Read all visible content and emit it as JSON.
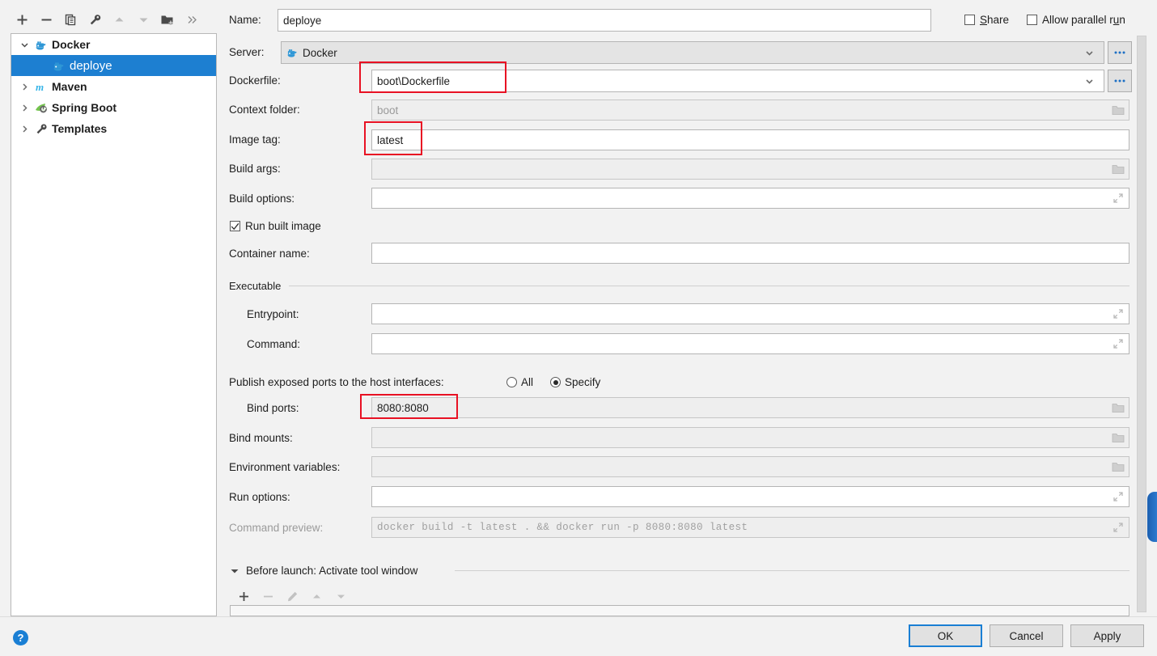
{
  "tree_toolbar": {
    "buttons": [
      {
        "name": "add",
        "icon": "plus-icon",
        "enabled": true
      },
      {
        "name": "remove",
        "icon": "minus-icon",
        "enabled": true
      },
      {
        "name": "copy",
        "icon": "copy-icon",
        "enabled": true
      },
      {
        "name": "edit-templates",
        "icon": "wrench-icon",
        "enabled": true
      },
      {
        "name": "move-up",
        "icon": "arrow-up-icon",
        "enabled": false
      },
      {
        "name": "move-down",
        "icon": "arrow-down-icon",
        "enabled": false
      },
      {
        "name": "new-folder",
        "icon": "folder-add-icon",
        "enabled": true
      },
      {
        "name": "more",
        "icon": "chevrons-right-icon",
        "enabled": true
      }
    ]
  },
  "tree": {
    "items": [
      {
        "label": "Docker",
        "icon": "docker-icon",
        "expanded": true,
        "selected": false,
        "level": 0
      },
      {
        "label": "deploye",
        "icon": "docker-icon",
        "expanded": null,
        "selected": true,
        "level": 1
      },
      {
        "label": "Maven",
        "icon": "maven-icon",
        "expanded": false,
        "selected": false,
        "level": 0
      },
      {
        "label": "Spring Boot",
        "icon": "spring-boot-icon",
        "expanded": false,
        "selected": false,
        "level": 0
      },
      {
        "label": "Templates",
        "icon": "wrench-icon",
        "expanded": false,
        "selected": false,
        "level": 0
      }
    ]
  },
  "header": {
    "name_label": "Name:",
    "name_value": "deploye",
    "share_label_pre": "S",
    "share_label_post": "hare",
    "allow_parallel_pre": "Allow parallel r",
    "allow_parallel_mn": "u",
    "allow_parallel_post": "n",
    "share_checked": false,
    "allow_parallel_checked": false
  },
  "form": {
    "server": {
      "label": "Server:",
      "value": "Docker",
      "icon": "docker-icon",
      "browse_label": "...",
      "enabled": false
    },
    "dockerfile": {
      "label": "Dockerfile:",
      "value": "boot\\Dockerfile",
      "browse_label": "...",
      "highlighted": true
    },
    "context_folder": {
      "label": "Context folder:",
      "value": "",
      "placeholder": "boot",
      "trailing_icon": "folder-icon",
      "disabled": true
    },
    "image_tag": {
      "label": "Image tag:",
      "value": "latest",
      "highlighted": true
    },
    "build_args": {
      "label": "Build args:",
      "value": "",
      "trailing_icon": "folder-icon",
      "disabled": true
    },
    "build_options": {
      "label": "Build options:",
      "value": "",
      "trailing_icon": "expand-icon",
      "disabled": false
    },
    "run_built_image": {
      "label": "Run built image",
      "checked": true
    },
    "container_name": {
      "label": "Container name:",
      "value": "",
      "disabled": false
    },
    "executable_group": {
      "title": "Executable",
      "entrypoint": {
        "label": "Entrypoint:",
        "value": "",
        "trailing_icon": "expand-icon"
      },
      "command": {
        "label": "Command:",
        "value": "",
        "trailing_icon": "expand-icon"
      }
    },
    "publish_ports": {
      "label": "Publish exposed ports to the host interfaces:",
      "options": [
        {
          "label": "All",
          "selected": false
        },
        {
          "label": "Specify",
          "selected": true
        }
      ]
    },
    "bind_ports": {
      "label": "Bind ports:",
      "value": "8080:8080",
      "trailing_icon": "folder-icon",
      "highlighted": true
    },
    "bind_mounts": {
      "label": "Bind mounts:",
      "value": "",
      "trailing_icon": "folder-icon",
      "disabled": true
    },
    "environment_variables": {
      "label": "Environment variables:",
      "value": "",
      "trailing_icon": "folder-icon",
      "disabled": true
    },
    "run_options": {
      "label": "Run options:",
      "value": "",
      "trailing_icon": "expand-icon",
      "disabled": false
    },
    "command_preview": {
      "label": "Command preview:",
      "value": "docker build -t latest . && docker run -p 8080:8080 latest",
      "trailing_icon": "expand-icon",
      "disabled": true
    }
  },
  "before_launch": {
    "title": "Before launch: Activate tool window",
    "expanded": true,
    "toolbar": [
      {
        "name": "add",
        "icon": "plus-icon",
        "enabled": true
      },
      {
        "name": "remove",
        "icon": "minus-icon",
        "enabled": false
      },
      {
        "name": "edit",
        "icon": "pencil-icon",
        "enabled": false
      },
      {
        "name": "move-up",
        "icon": "arrow-up-icon",
        "enabled": false
      },
      {
        "name": "move-down",
        "icon": "arrow-down-icon",
        "enabled": false
      }
    ]
  },
  "footer": {
    "ok_label": "OK",
    "cancel_label": "Cancel",
    "apply_label": "Apply",
    "help_label": "?"
  },
  "colors": {
    "accent": "#1d7fd1",
    "highlight": "#e81123",
    "window_bg": "#f2f2f2",
    "field_bg": "#ffffff",
    "disabled_bg": "#eeeeee"
  }
}
